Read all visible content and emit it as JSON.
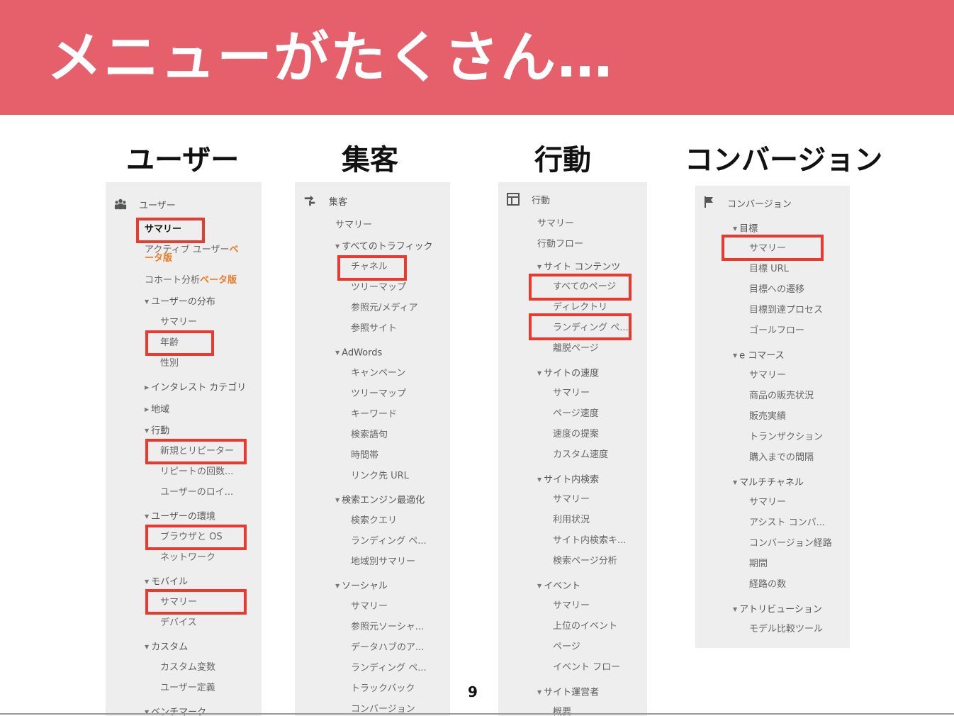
{
  "slide": {
    "title": "メニューがたくさん…",
    "page_number": "9"
  },
  "colors": {
    "banner": "#e5606a",
    "highlight": "#ea3a2d",
    "beta": "#f07a22",
    "panel": "#eeeeee"
  },
  "columns": {
    "users": {
      "heading": "ユーザー",
      "header_label": "ユーザー",
      "icon": "users-icon",
      "items": {
        "i0": "サマリー",
        "i1": "アクティブ ユーザー",
        "i1b": "ベ",
        "i1c": "ータ版",
        "i2": "コホート分析",
        "i2b": "ベータ版",
        "i3": "ユーザーの分布",
        "i4": "サマリー",
        "i5": "年齢",
        "i6": "性別",
        "i7": "インタレスト カテゴリ",
        "i8": "地域",
        "i9": "行動",
        "i10": "新規とリピーター",
        "i11": "リピートの回数...",
        "i12": "ユーザーのロイ...",
        "i13": "ユーザーの環境",
        "i14": "ブラウザと OS",
        "i15": "ネットワーク",
        "i16": "モバイル",
        "i17": "サマリー",
        "i18": "デバイス",
        "i19": "カスタム",
        "i20": "カスタム変数",
        "i21": "ユーザー定義",
        "i22": "ベンチマーク"
      }
    },
    "acquisition": {
      "heading": "集客",
      "header_label": "集客",
      "icon": "acquisition-arrows-icon",
      "items": {
        "i0": "サマリー",
        "i1": "すべてのトラフィック",
        "i2": "チャネル",
        "i3": "ツリーマップ",
        "i4": "参照元/メディア",
        "i5": "参照サイト",
        "i6": "AdWords",
        "i7": "キャンペーン",
        "i8": "ツリーマップ",
        "i9": "キーワード",
        "i10": "検索語句",
        "i11": "時間帯",
        "i12": "リンク先 URL",
        "i13": "検索エンジン最適化",
        "i14": "検索クエリ",
        "i15": "ランディング ペ...",
        "i16": "地域別サマリー",
        "i17": "ソーシャル",
        "i18": "サマリー",
        "i19": "参照元ソーシャ...",
        "i20": "データハブのア...",
        "i21": "ランディング ペ...",
        "i22": "トラックバック",
        "i23": "コンバージョン"
      }
    },
    "behavior": {
      "heading": "行動",
      "header_label": "行動",
      "icon": "behavior-layout-icon",
      "items": {
        "i0": "サマリー",
        "i1": "行動フロー",
        "i2": "サイト コンテンツ",
        "i3": "すべてのページ",
        "i4": "ディレクトリ",
        "i5": "ランディング ペ...",
        "i6": "離脱ページ",
        "i7": "サイトの速度",
        "i8": "サマリー",
        "i9": "ページ速度",
        "i10": "速度の提案",
        "i11": "カスタム速度",
        "i12": "サイト内検索",
        "i13": "サマリー",
        "i14": "利用状況",
        "i15": "サイト内検索キ...",
        "i16": "検索ページ分析",
        "i17": "イベント",
        "i18": "サマリー",
        "i19": "上位のイベント",
        "i20": "ページ",
        "i21": "イベント フロー",
        "i22": "サイト運営者",
        "i23": "概要"
      }
    },
    "conversion": {
      "heading": "コンバージョン",
      "header_label": "コンバージョン",
      "icon": "flag-icon",
      "items": {
        "i0": "目標",
        "i1": "サマリー",
        "i2": "目標 URL",
        "i3": "目標への遷移",
        "i4": "目標到達プロセス",
        "i5": "ゴールフロー",
        "i6": "e コマース",
        "i7": "サマリー",
        "i8": "商品の販売状況",
        "i9": "販売実績",
        "i10": "トランザクション",
        "i11": "購入までの間隔",
        "i12": "マルチチャネル",
        "i13": "サマリー",
        "i14": "アシスト コンバ...",
        "i15": "コンバージョン経路",
        "i16": "期間",
        "i17": "経路の数",
        "i18": "アトリビューション",
        "i19": "モデル比較ツール"
      }
    }
  }
}
